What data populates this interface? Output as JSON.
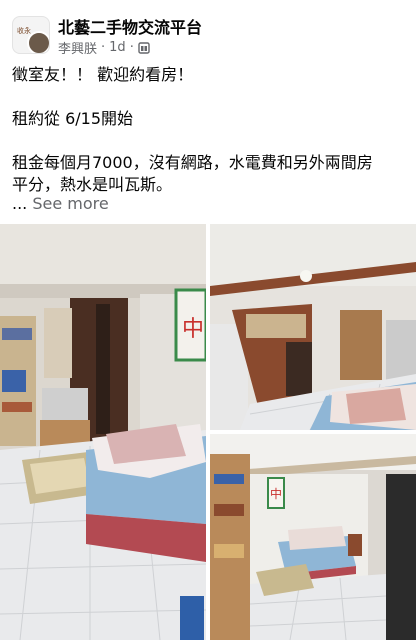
{
  "header": {
    "group_name": "北藝二手物交流平台",
    "author": "李興朕",
    "time": "1d",
    "dot": "·",
    "avatar_text": "收永"
  },
  "post": {
    "line1": "徵室友！！ 歡迎約看房！",
    "line2": "租約從 6/15開始",
    "line3": "租金每個月7000，沒有網路，水電費和另外兩間房",
    "line4": "平分，熱水是叫瓦斯。",
    "ellipsis": "...",
    "see_more": "See more"
  },
  "photos": {
    "sign_char": "中",
    "items": [
      "bedroom-photo-1",
      "bedroom-photo-2",
      "bedroom-photo-3"
    ]
  },
  "colors": {
    "meta_gray": "#65676b",
    "text": "#050505",
    "mattress_blue": "#8fb6d6",
    "bed_frame_red": "#b34a52",
    "wardrobe_brown": "#8a4a2e",
    "floor_tile": "#e9eaec",
    "sign_green": "#3a8a4a",
    "sign_red": "#c8302c"
  },
  "icons": {
    "privacy": "group-privacy-icon"
  }
}
